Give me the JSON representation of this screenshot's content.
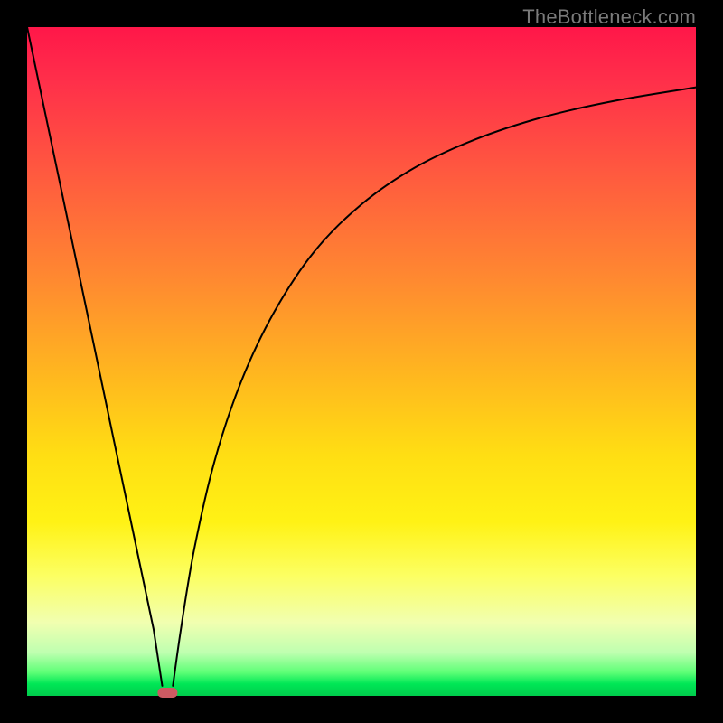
{
  "watermark": {
    "text": "TheBottleneck.com"
  },
  "colors": {
    "frame": "#000000",
    "curve": "#000000",
    "marker": "#cc5a62",
    "gradient_stops": [
      "#ff1749",
      "#ff2f4a",
      "#ff5a3f",
      "#ff8a30",
      "#ffb71f",
      "#ffde13",
      "#fff215",
      "#fcff62",
      "#f1ffb0",
      "#bfffb0",
      "#5dff76",
      "#00e756",
      "#00d850",
      "#00cc4c"
    ]
  },
  "chart_data": {
    "type": "line",
    "title": "",
    "xlabel": "",
    "ylabel": "",
    "x_range": [
      0,
      100
    ],
    "y_range": [
      0,
      100
    ],
    "marker": {
      "x": 21,
      "y": 0,
      "shape": "rounded-rect"
    },
    "series": [
      {
        "name": "left-branch",
        "x": [
          0,
          4.2,
          8.4,
          12.6,
          16.8,
          18.9,
          20.2
        ],
        "y": [
          100,
          80,
          60,
          40,
          20,
          10,
          1.5
        ]
      },
      {
        "name": "right-branch",
        "x": [
          21.8,
          23,
          25,
          28,
          32,
          37,
          43,
          50,
          58,
          67,
          77,
          88,
          100
        ],
        "y": [
          1.5,
          10,
          22,
          35,
          47,
          57.5,
          66.5,
          73.5,
          79,
          83.2,
          86.5,
          89,
          91
        ]
      }
    ],
    "notes": "Axes are unlabeled in the source image; x/y are percent of plot width/height. y=0 at bottom, y=100 at top."
  }
}
